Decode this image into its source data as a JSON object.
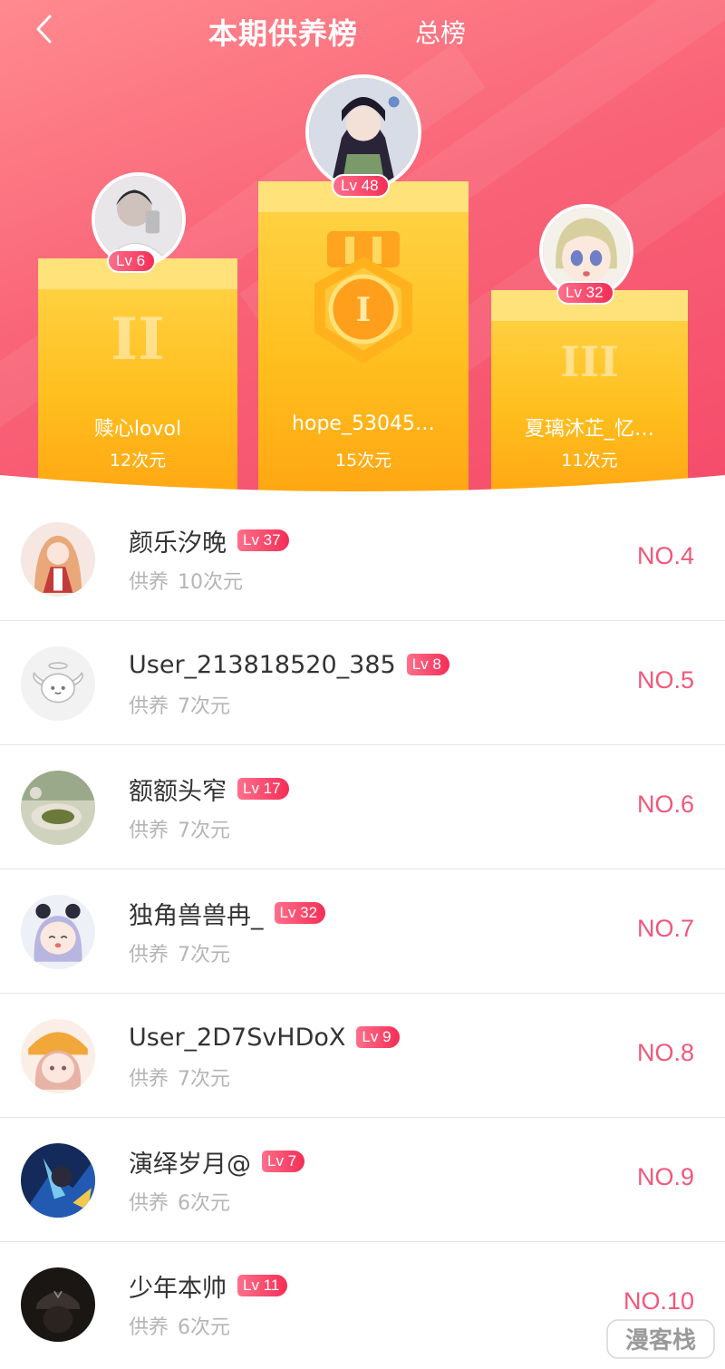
{
  "header": {
    "title": "本期供养榜",
    "tab_total": "总榜"
  },
  "colors": {
    "accent": "#f44b6a",
    "gold": "#ffbf1e",
    "rank": "#f2577a",
    "level_badge": "#f32e56"
  },
  "podium": {
    "first": {
      "name": "hope_53045…",
      "amount": "15次元",
      "level": "Lv 48",
      "medal_label": "I"
    },
    "second": {
      "name": "赎心lovol",
      "amount": "12次元",
      "level": "Lv 6",
      "numeral": "II"
    },
    "third": {
      "name": "夏璃沐芷_忆…",
      "amount": "11次元",
      "level": "Lv 32",
      "numeral": "III"
    }
  },
  "list": {
    "amount_label": "供养",
    "rows": [
      {
        "name": "颜乐汐晚",
        "level": "Lv 37",
        "amount": "10次元",
        "rank": "NO.4"
      },
      {
        "name": "User_213818520_385",
        "level": "Lv 8",
        "amount": "7次元",
        "rank": "NO.5"
      },
      {
        "name": "额额头窄",
        "level": "Lv 17",
        "amount": "7次元",
        "rank": "NO.6"
      },
      {
        "name": "独角兽兽冉_",
        "level": "Lv 32",
        "amount": "7次元",
        "rank": "NO.7"
      },
      {
        "name": "User_2D7SvHDoX",
        "level": "Lv 9",
        "amount": "7次元",
        "rank": "NO.8"
      },
      {
        "name": "演绎岁月@",
        "level": "Lv 7",
        "amount": "6次元",
        "rank": "NO.9"
      },
      {
        "name": "少年本帅",
        "level": "Lv 11",
        "amount": "6次元",
        "rank": "NO.10"
      }
    ]
  },
  "watermark": "漫客栈"
}
